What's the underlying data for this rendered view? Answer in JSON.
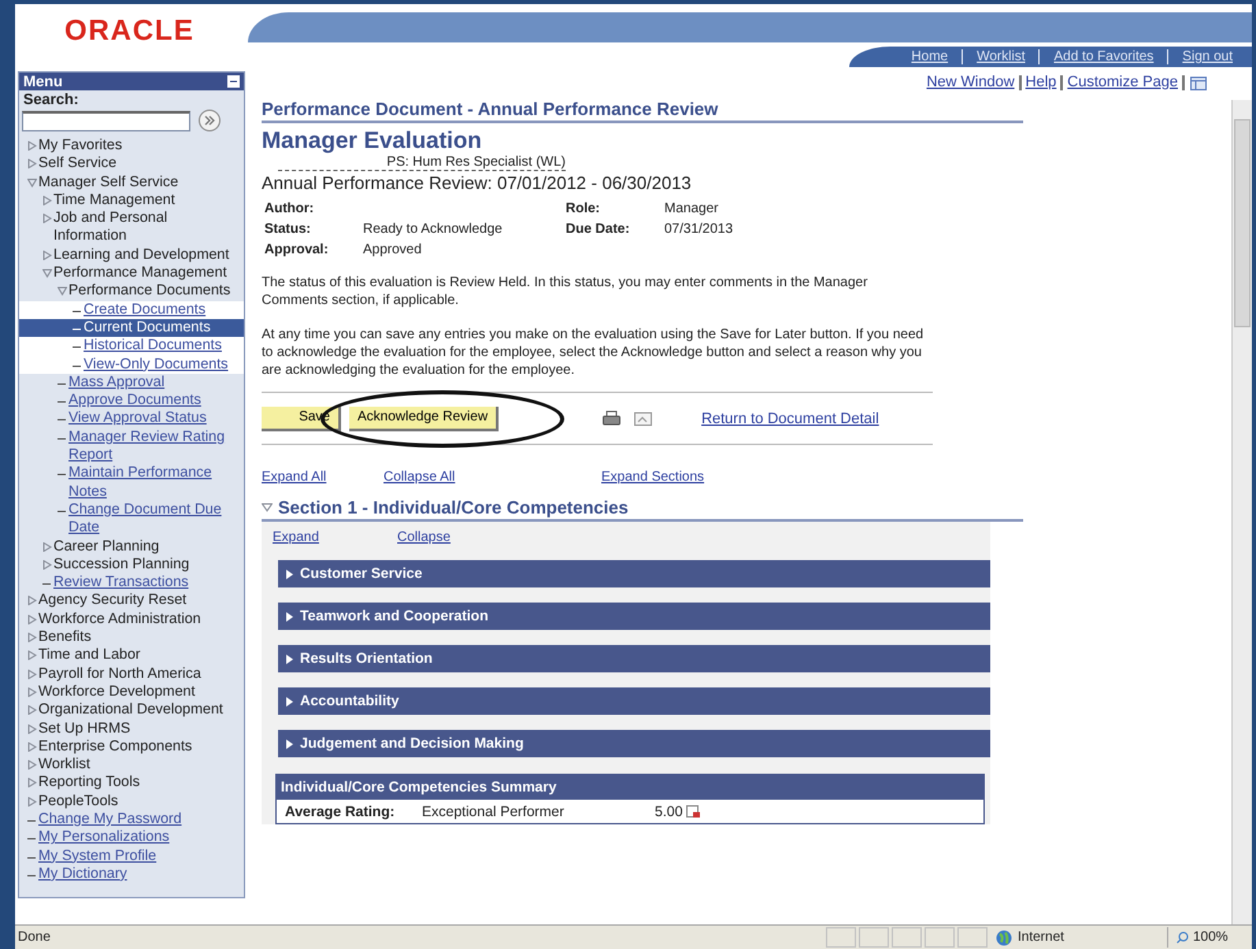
{
  "header": {
    "logo": "ORACLE",
    "nav_links": [
      "Home",
      "Worklist",
      "Add to Favorites",
      "Sign out"
    ]
  },
  "menu": {
    "title": "Menu",
    "search_label": "Search:",
    "items": [
      {
        "label": "My Favorites",
        "kind": "folder",
        "expanded": false,
        "selected": false
      },
      {
        "label": "Self Service",
        "kind": "folder",
        "expanded": false,
        "selected": false
      },
      {
        "label": "Manager Self Service",
        "kind": "folder",
        "expanded": true,
        "selected": false,
        "children": [
          {
            "label": "Time Management",
            "kind": "folder",
            "expanded": false,
            "selected": false
          },
          {
            "label": "Job and Personal Information",
            "kind": "folder",
            "expanded": false,
            "selected": false
          },
          {
            "label": "Learning and Development",
            "kind": "folder",
            "expanded": false,
            "selected": false
          },
          {
            "label": "Performance Management",
            "kind": "folder",
            "expanded": true,
            "selected": false,
            "children": [
              {
                "label": "Performance Documents",
                "kind": "folder",
                "expanded": true,
                "selected": false,
                "children": [
                  {
                    "label": "Create Documents",
                    "kind": "link",
                    "selected": false
                  },
                  {
                    "label": "Current Documents",
                    "kind": "link",
                    "selected": true
                  },
                  {
                    "label": "Historical Documents",
                    "kind": "link",
                    "selected": false
                  },
                  {
                    "label": "View-Only Documents",
                    "kind": "link",
                    "selected": false
                  }
                ]
              },
              {
                "label": "Mass Approval",
                "kind": "link",
                "selected": false
              },
              {
                "label": "Approve Documents",
                "kind": "link",
                "selected": false
              },
              {
                "label": "View Approval Status",
                "kind": "link",
                "selected": false
              },
              {
                "label": "Manager Review Rating Report",
                "kind": "link",
                "selected": false
              },
              {
                "label": "Maintain Performance Notes",
                "kind": "link",
                "selected": false
              },
              {
                "label": "Change Document Due Date",
                "kind": "link",
                "selected": false
              }
            ]
          },
          {
            "label": "Career Planning",
            "kind": "folder",
            "expanded": false,
            "selected": false
          },
          {
            "label": "Succession Planning",
            "kind": "folder",
            "expanded": false,
            "selected": false
          },
          {
            "label": "Review Transactions",
            "kind": "link",
            "selected": false
          }
        ]
      },
      {
        "label": "Agency Security Reset",
        "kind": "folder",
        "expanded": false,
        "selected": false
      },
      {
        "label": "Workforce Administration",
        "kind": "folder",
        "expanded": false,
        "selected": false
      },
      {
        "label": "Benefits",
        "kind": "folder",
        "expanded": false,
        "selected": false
      },
      {
        "label": "Time and Labor",
        "kind": "folder",
        "expanded": false,
        "selected": false
      },
      {
        "label": "Payroll for North America",
        "kind": "folder",
        "expanded": false,
        "selected": false
      },
      {
        "label": "Workforce Development",
        "kind": "folder",
        "expanded": false,
        "selected": false
      },
      {
        "label": "Organizational Development",
        "kind": "folder",
        "expanded": false,
        "selected": false
      },
      {
        "label": "Set Up HRMS",
        "kind": "folder",
        "expanded": false,
        "selected": false
      },
      {
        "label": "Enterprise Components",
        "kind": "folder",
        "expanded": false,
        "selected": false
      },
      {
        "label": "Worklist",
        "kind": "folder",
        "expanded": false,
        "selected": false
      },
      {
        "label": "Reporting Tools",
        "kind": "folder",
        "expanded": false,
        "selected": false
      },
      {
        "label": "PeopleTools",
        "kind": "folder",
        "expanded": false,
        "selected": false
      },
      {
        "label": "Change My Password",
        "kind": "link",
        "selected": false
      },
      {
        "label": "My Personalizations",
        "kind": "link",
        "selected": false
      },
      {
        "label": "My System Profile",
        "kind": "link",
        "selected": false
      },
      {
        "label": "My Dictionary",
        "kind": "link",
        "selected": false
      }
    ]
  },
  "page_links": [
    "New Window",
    "Help",
    "Customize Page"
  ],
  "document": {
    "heading": "Performance Document - Annual Performance Review",
    "title": "Manager Evaluation",
    "job_title": "PS: Hum Res Specialist (WL)",
    "period": "Annual Performance Review: 07/01/2012 - 06/30/2013",
    "fields": [
      {
        "label": "Author:",
        "label_2": "Role:",
        "value_2": "Manager"
      },
      {
        "label": "Status:",
        "value": "Ready to Acknowledge",
        "label_2": "Due Date:",
        "value_2": "07/31/2013"
      },
      {
        "label": "Approval:",
        "value": "Approved"
      }
    ],
    "paragraphs": [
      "The status of this evaluation is Review Held. In this status, you may enter comments in the Manager Comments section, if applicable.",
      "At any time you can save any entries you make on the evaluation using the Save for Later button. If you need to acknowledge the evaluation for the employee, select the Acknowledge button and select a reason why you are acknowledging the evaluation for the employee."
    ],
    "buttons": [
      "Save",
      "Acknowledge Review"
    ],
    "return_link": "Return to Document Detail",
    "expand_links": [
      "Expand All",
      "Collapse All",
      "Expand Sections"
    ]
  },
  "section": {
    "title": "Section 1 - Individual/Core Competencies",
    "expanded": true,
    "links": [
      "Expand",
      "Collapse"
    ],
    "competencies": [
      {
        "label": "Customer Service",
        "expanded": false
      },
      {
        "label": "Teamwork and Cooperation",
        "expanded": false
      },
      {
        "label": "Results Orientation",
        "expanded": false
      },
      {
        "label": "Accountability",
        "expanded": false
      },
      {
        "label": "Judgement and Decision Making",
        "expanded": false
      }
    ],
    "summary": {
      "title": "Individual/Core Competencies Summary",
      "label": "Average Rating:",
      "rating": "Exceptional Performer",
      "score": "5.00"
    }
  },
  "status_bar": {
    "text": "Done",
    "zone": "Internet",
    "zoom": "100%"
  }
}
